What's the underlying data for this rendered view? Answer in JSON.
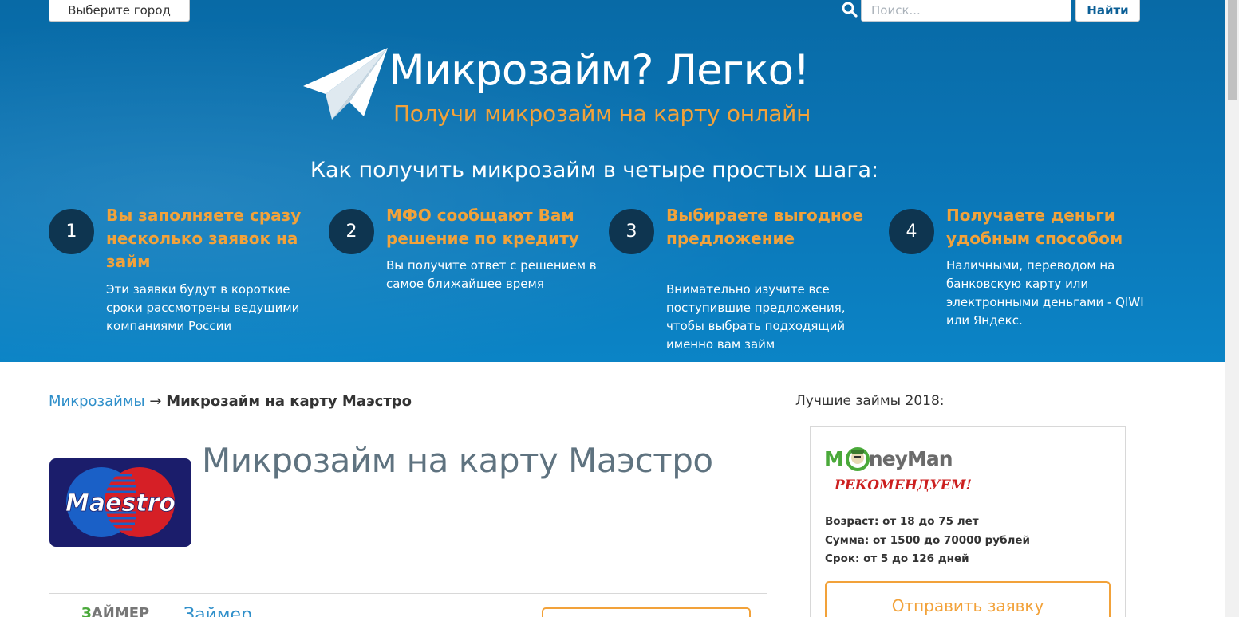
{
  "header": {
    "city_button": "Выберите город",
    "search_placeholder": "Поиск...",
    "find_button": "Найти"
  },
  "hero": {
    "title": "Микрозайм? Легко!",
    "subtitle": "Получи микрозайм на карту онлайн",
    "steps_heading": "Как получить микрозайм в четыре простых шага:",
    "steps": [
      {
        "number": "1",
        "title": "Вы заполняете сразу несколько заявок на займ",
        "text": "Эти заявки будут в короткие сроки рассмотрены ведущими компаниями России"
      },
      {
        "number": "2",
        "title": "МФО сообщают Вам решение по кредиту",
        "text": "Вы получите ответ с решением в самое ближайшее время"
      },
      {
        "number": "3",
        "title": "Выбираете выгодное предложение",
        "text": "Внимательно изучите все поступившие предложения, чтобы выбрать подходящий именно вам займ"
      },
      {
        "number": "4",
        "title": "Получаете деньги удобным способом",
        "text": "Наличными, переводом на банковскую карту или электронными деньгами - QIWI или Яндекс."
      }
    ]
  },
  "breadcrumb": {
    "link": "Микрозаймы",
    "arrow": "→",
    "current": "Микрозайм на карту Маэстро"
  },
  "main": {
    "card_logo_text": "Maestro",
    "page_title": "Микрозайм на карту Маэстро",
    "offer": {
      "logo_prefix": "З",
      "logo_text": "АЙМЕР",
      "name": "Займер"
    }
  },
  "sidebar": {
    "heading": "Лучшие займы 2018:",
    "card": {
      "logo_left": "M",
      "logo_right": "neyMan",
      "badge": "РЕКОМЕНДУЕМ!",
      "age": "Возраст: от 18 до 75 лет",
      "sum": "Сумма: от 1500 до 70000 рублей",
      "term": "Срок: от 5 до 126 дней",
      "button": "Отправить заявку"
    }
  },
  "colors": {
    "hero_blue": "#0b77b8",
    "accent_orange": "#f2a23a",
    "step_circle": "#0e3550",
    "link_blue": "#2f8fca"
  }
}
